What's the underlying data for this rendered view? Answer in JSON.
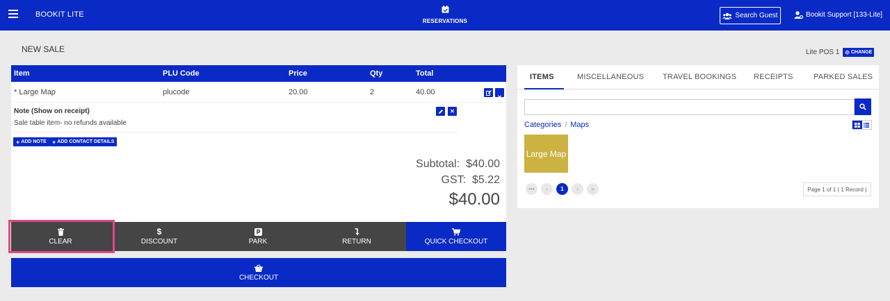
{
  "app": {
    "title": "BOOKIT LITE"
  },
  "nav": {
    "reservations_label": "RESERVATIONS",
    "search_guest_label": "Search Guest",
    "user_label": "Bookit Support [133-Lite]"
  },
  "page": {
    "title": "NEW SALE",
    "pos_label": "Lite POS 1",
    "change_label": "CHANGE"
  },
  "sale_table": {
    "columns": [
      "Item",
      "PLU Code",
      "Price",
      "Qty",
      "Total"
    ],
    "rows": [
      {
        "item": "* Large Map",
        "plu": "plucode",
        "price": "20.00",
        "qty": "2",
        "total": "40.00"
      }
    ],
    "note": {
      "title": "Note (Show on receipt)",
      "text": "Sale table item- no refunds available"
    },
    "add_note_label": "ADD NOTE",
    "add_contact_label": "ADD CONTACT DETAILS"
  },
  "totals": {
    "subtotal": "Subtotal:  $40.00",
    "gst": "GST:  $5.22",
    "grand": "$40.00"
  },
  "actions": {
    "clear": "CLEAR",
    "discount": "DISCOUNT",
    "park": "PARK",
    "return": "RETURN",
    "quick_checkout": "QUICK CHECKOUT",
    "checkout": "CHECKOUT"
  },
  "items_panel": {
    "tabs": [
      "ITEMS",
      "MISCELLANEOUS",
      "TRAVEL BOOKINGS",
      "RECEIPTS",
      "PARKED SALES"
    ],
    "active_tab": "ITEMS",
    "search_placeholder": "",
    "breadcrumb": [
      "Categories",
      "Maps"
    ],
    "tiles": [
      {
        "label": "Large Map"
      }
    ],
    "pager": {
      "current": "1",
      "info": "Page 1 of 1 ( 1 Record )"
    }
  },
  "colors": {
    "primary": "#0a2ac6",
    "dark_button": "#454545",
    "tile": "#ccb341",
    "highlight": "#e14783"
  }
}
